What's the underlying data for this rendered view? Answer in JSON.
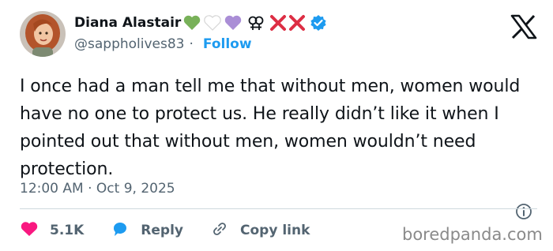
{
  "user": {
    "display_name": "Diana Alastair",
    "handle": "@sappholives83",
    "separator": "·",
    "follow_label": "Follow"
  },
  "tweet": {
    "text": "I once had a man tell me that without men, women would have no one to protect us. He really didn’t like it when I pointed out that without men, women wouldn’t need protection.",
    "time": "12:00 AM",
    "date": "Oct 9, 2025"
  },
  "actions": {
    "likes": "5.1K",
    "reply_label": "Reply",
    "copy_label": "Copy link"
  },
  "watermark": "boredpanda.com",
  "icons": {
    "name_emojis": [
      "green-heart-icon",
      "white-heart-icon",
      "purple-heart-icon",
      "lesbian-symbol-icon",
      "cross-mark-icon",
      "cross-mark-icon",
      "verified-badge-icon"
    ],
    "logo": "x-logo-icon"
  },
  "colors": {
    "link_blue": "#1d9bf0",
    "heart_pink": "#f91880",
    "text_gray": "#536471"
  }
}
